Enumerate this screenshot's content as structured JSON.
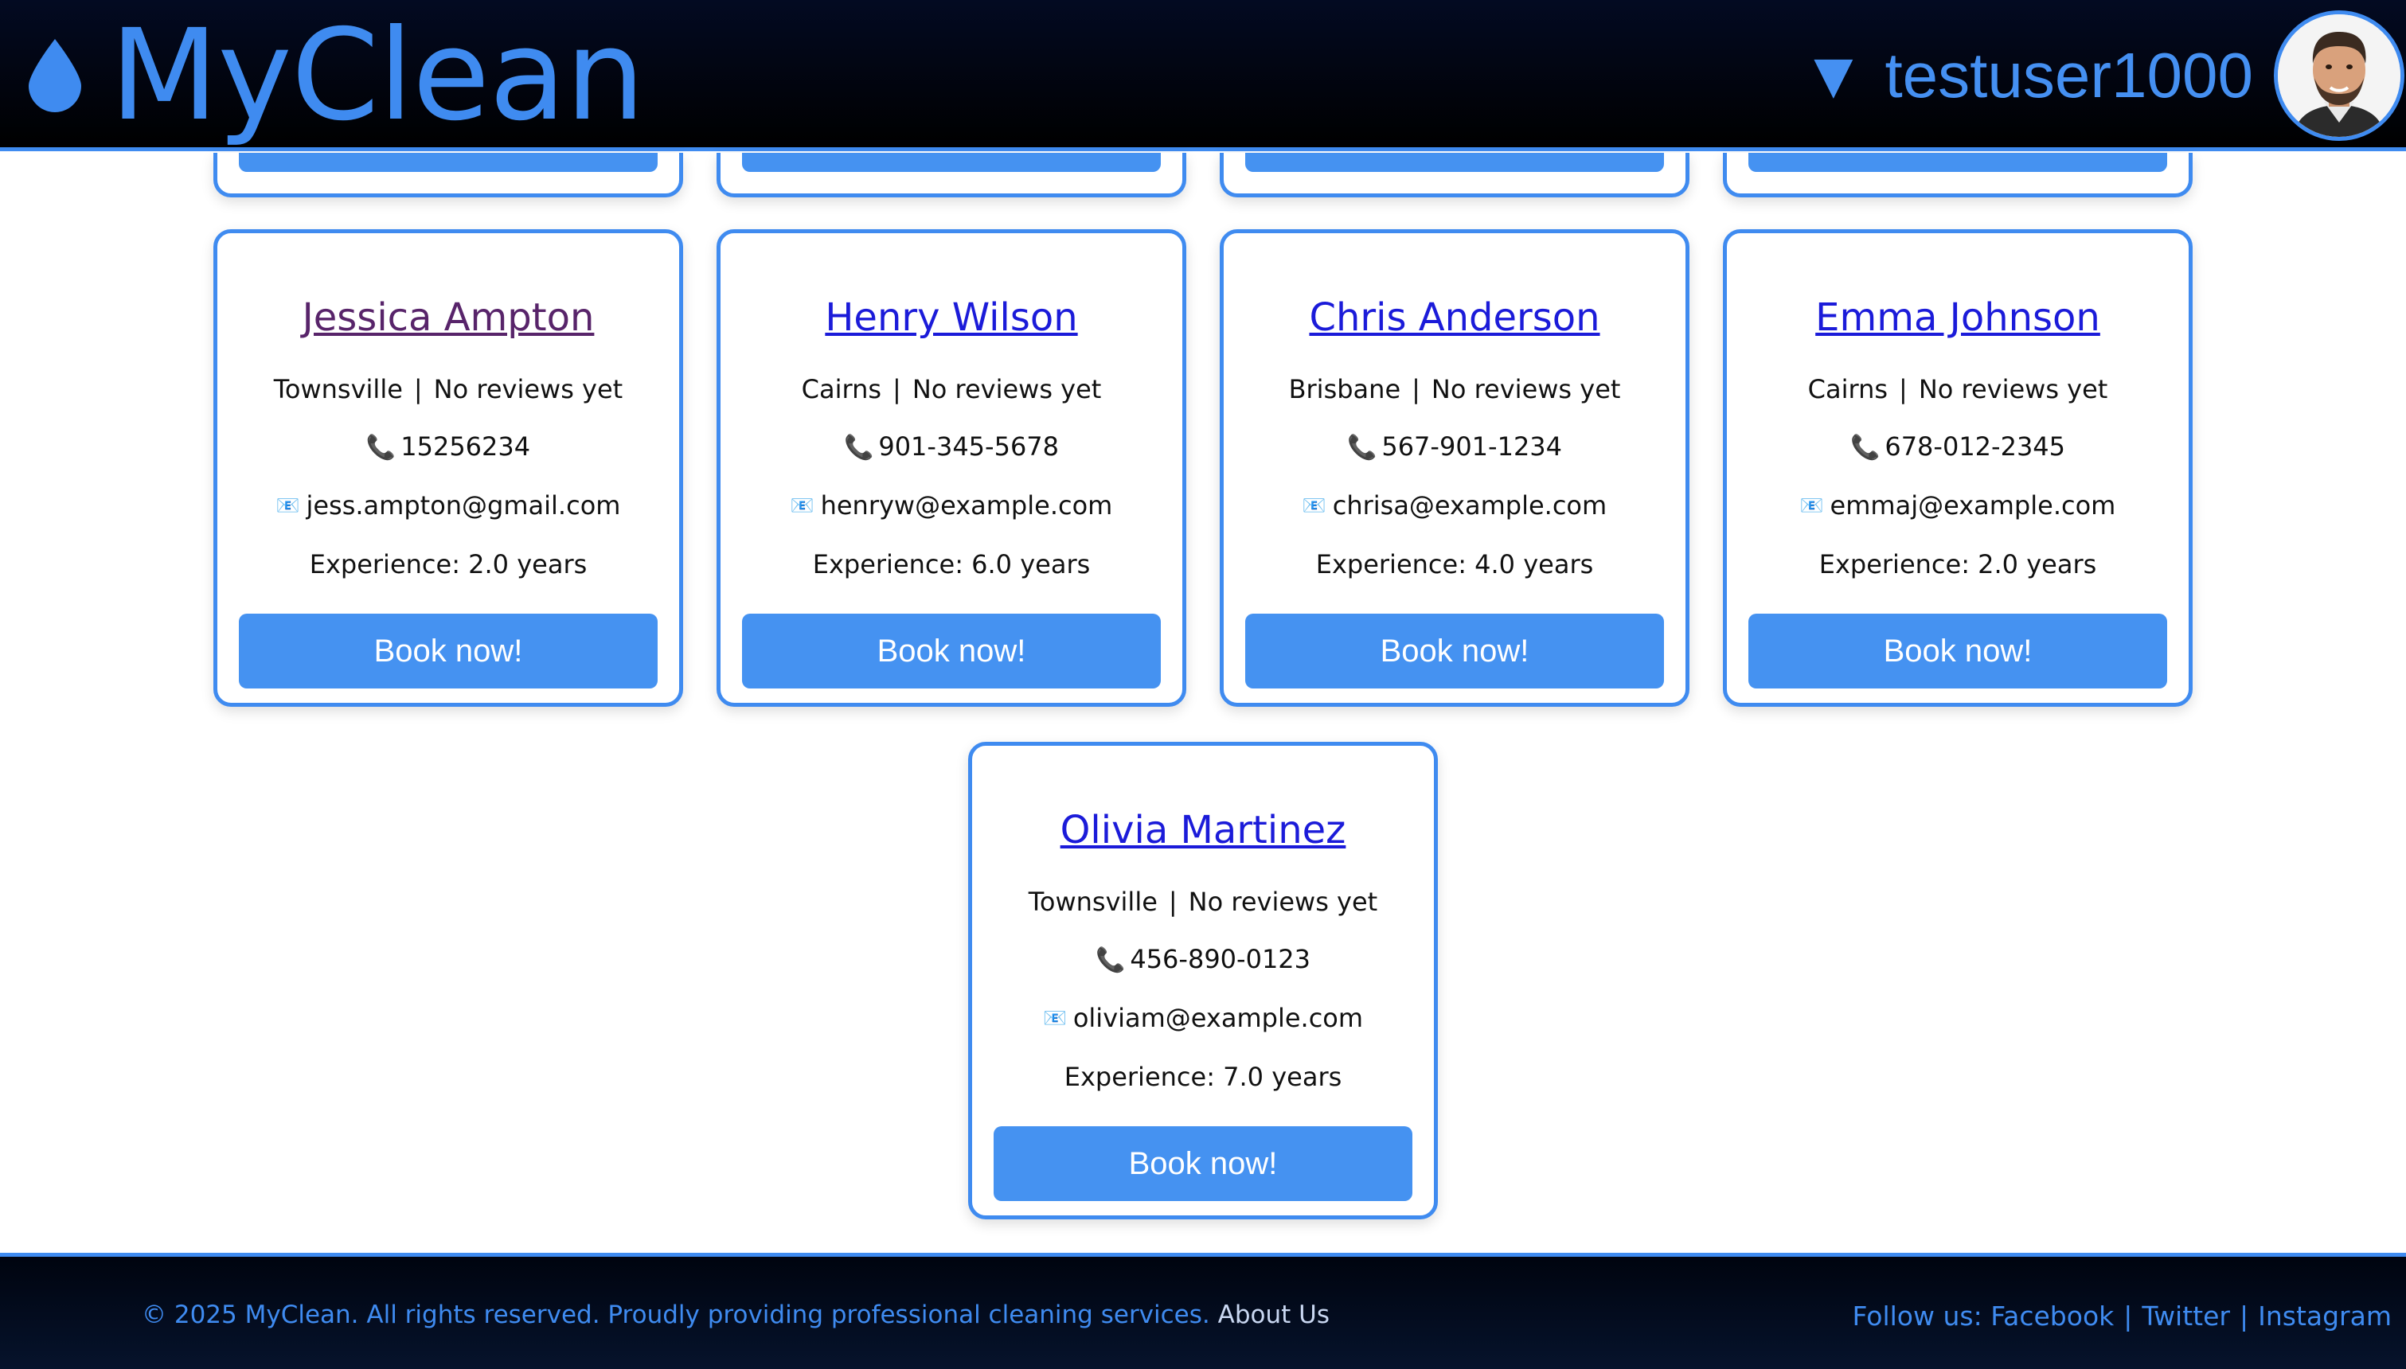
{
  "header": {
    "logo_text": "MyClean",
    "user_caret": "▼",
    "username": "testuser1000",
    "logo_icon": "water-drop-icon",
    "accent_color": "#3f8bf0"
  },
  "cleaners": [
    {
      "name": "Jessica Ampton",
      "location": "Townsville",
      "reviews": "No reviews yet",
      "phone": "15256234",
      "email": "jess.ampton@gmail.com",
      "experience": "Experience: 2.0 years",
      "button": "Book now!"
    },
    {
      "name": "Henry Wilson",
      "location": "Cairns",
      "reviews": "No reviews yet",
      "phone": "901-345-5678",
      "email": "henryw@example.com",
      "experience": "Experience: 6.0 years",
      "button": "Book now!"
    },
    {
      "name": "Chris Anderson",
      "location": "Brisbane",
      "reviews": "No reviews yet",
      "phone": "567-901-1234",
      "email": "chrisa@example.com",
      "experience": "Experience: 4.0 years",
      "button": "Book now!"
    },
    {
      "name": "Emma Johnson",
      "location": "Cairns",
      "reviews": "No reviews yet",
      "phone": "678-012-2345",
      "email": "emmaj@example.com",
      "experience": "Experience: 2.0 years",
      "button": "Book now!"
    },
    {
      "name": "Olivia Martinez",
      "location": "Townsville",
      "reviews": "No reviews yet",
      "phone": "456-890-0123",
      "email": "oliviam@example.com",
      "experience": "Experience: 7.0 years",
      "button": "Book now!"
    }
  ],
  "separator": "|",
  "icons": {
    "phone": "📞",
    "email": "📧"
  },
  "footer": {
    "copyright": "© 2025 MyClean. All rights reserved. Proudly providing professional cleaning services.",
    "about": "About Us",
    "follow_label": "Follow us:",
    "links": [
      "Facebook",
      "Twitter",
      "Instagram"
    ],
    "link_separator": "|"
  }
}
